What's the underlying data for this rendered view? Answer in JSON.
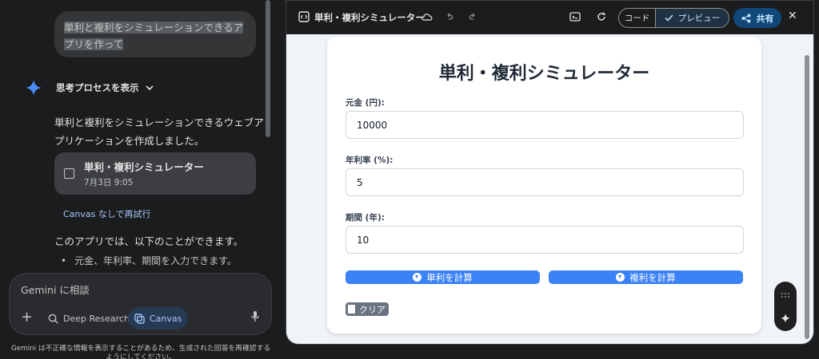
{
  "chat": {
    "user_prompt": "単利と複利をシミュレーションできるアプリを作って",
    "thought_label": "思考プロセスを表示",
    "response_text": "単利と複利をシミュレーションできるウェブアプリケーションを作成しました。",
    "card": {
      "title": "単利・複利シミュレーター",
      "date": "7月3日 9:05"
    },
    "retry_label": "Canvas なしで再試行",
    "app_intro": "このアプリでは、以下のことができます。",
    "bullet": "元金、年利率、期間を入力できます。"
  },
  "composer": {
    "placeholder": "Gemini に相談",
    "deep_research": "Deep Research",
    "canvas": "Canvas",
    "disclaimer": "Gemini は不正確な情報を表示することがあるため、生成された回答を再確認するようにしてください。"
  },
  "canvas_toolbar": {
    "title": "単利・複利シミュレーター",
    "code_label": "コード",
    "preview_label": "プレビュー",
    "share_label": "共有"
  },
  "simulator": {
    "title": "単利・複利シミュレーター",
    "principal_label": "元金 (円):",
    "principal_value": "10000",
    "rate_label": "年利率 (%):",
    "rate_value": "5",
    "period_label": "期間 (年):",
    "period_value": "10",
    "simple_btn": "単利を計算",
    "compound_btn": "複利を計算",
    "clear_btn": "クリア"
  },
  "colors": {
    "accent": "#3b82f6",
    "preview_active": "#213144",
    "share_bg": "#10487a"
  }
}
